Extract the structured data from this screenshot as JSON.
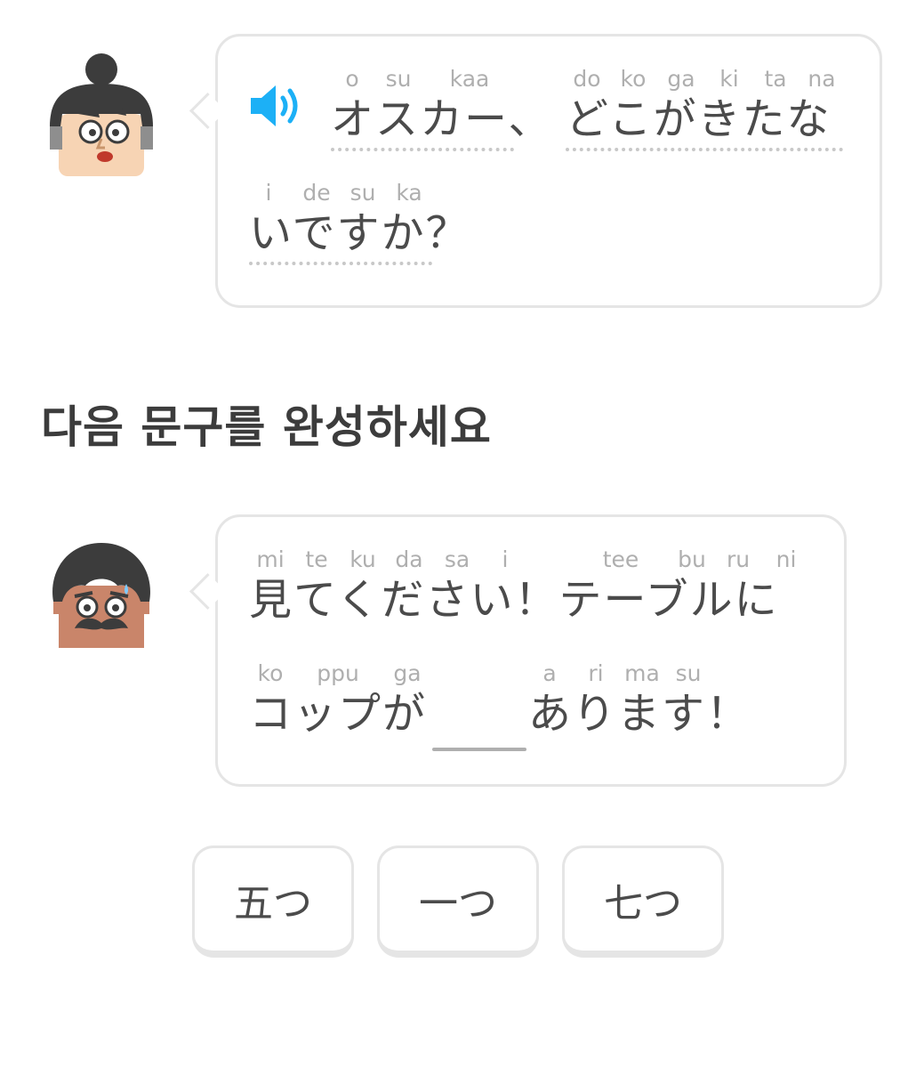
{
  "prompt1": {
    "speaker": "oscar-avatar",
    "segments": [
      {
        "romaji": [
          "o",
          "su",
          "kaa"
        ],
        "text": "オスカー、"
      },
      {
        "romaji": [
          "do",
          "ko",
          "ga",
          "ki",
          "ta",
          "na"
        ],
        "text": "どこがきたな"
      },
      {
        "romaji": [
          "i",
          "de",
          "su",
          "ka"
        ],
        "text": "いですか？"
      }
    ]
  },
  "instruction": "다음 문구를 완성하세요",
  "prompt2": {
    "speaker": "mustache-man-avatar",
    "line1": {
      "romaji": [
        "mi",
        "te",
        "ku",
        "da",
        "sa",
        "i",
        "tee",
        "bu",
        "ru",
        "ni"
      ],
      "text": "見てください！テーブルに"
    },
    "line2": {
      "romaji_a": [
        "ko",
        "ppu",
        "ga"
      ],
      "text_a": "コップが",
      "romaji_b": [
        "a",
        "ri",
        "ma",
        "su"
      ],
      "text_b": "あります！"
    }
  },
  "choices": [
    "五つ",
    "一つ",
    "七つ"
  ],
  "icons": {
    "speaker": "speaker-icon"
  },
  "colors": {
    "accent": "#1cb0f6",
    "border": "#e5e5e5",
    "hint": "#afafaf",
    "text": "#4b4b4b"
  }
}
